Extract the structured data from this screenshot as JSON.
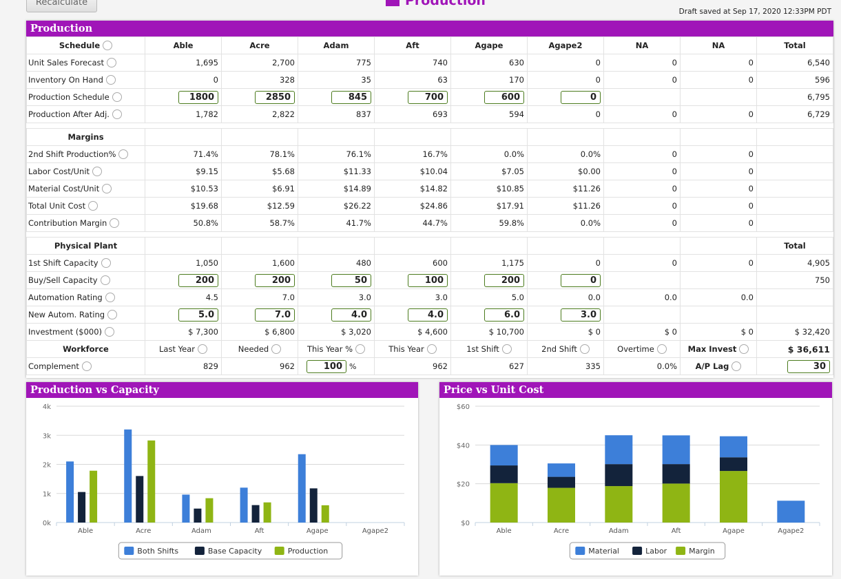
{
  "header": {
    "recalculate_label": "Recalculate",
    "page_title": "Production",
    "draft_saved": "Draft saved at Sep 17, 2020 12:33PM PDT"
  },
  "production_panel": {
    "title": "Production",
    "rows": [
      {
        "type": "head",
        "label": "Schedule",
        "info": true,
        "cells": [
          "Able",
          "Acre",
          "Adam",
          "Aft",
          "Agape",
          "Agape2",
          "NA",
          "NA",
          "Total"
        ]
      },
      {
        "label": "Unit Sales Forecast",
        "info": true,
        "cells": [
          "1,695",
          "2,700",
          "775",
          "740",
          "630",
          "0",
          "0",
          "0",
          "6,540"
        ]
      },
      {
        "label": "Inventory On Hand",
        "info": true,
        "cells": [
          "0",
          "328",
          "35",
          "63",
          "170",
          "0",
          "0",
          "0",
          "596"
        ]
      },
      {
        "label": "Production Schedule",
        "info": true,
        "cells": [
          {
            "input": "1800"
          },
          {
            "input": "2850"
          },
          {
            "input": "845"
          },
          {
            "input": "700"
          },
          {
            "input": "600"
          },
          {
            "input": "0"
          },
          "",
          "",
          "6,795"
        ]
      },
      {
        "label": "Production After Adj.",
        "info": true,
        "cells": [
          "1,782",
          "2,822",
          "837",
          "693",
          "594",
          "0",
          "0",
          "0",
          "6,729"
        ]
      },
      {
        "type": "gap"
      },
      {
        "type": "head",
        "label": "Margins",
        "cells": [
          "",
          "",
          "",
          "",
          "",
          "",
          "",
          "",
          ""
        ]
      },
      {
        "label": "2nd Shift Production%",
        "info": true,
        "cells": [
          "71.4%",
          "78.1%",
          "76.1%",
          "16.7%",
          "0.0%",
          "0.0%",
          "0",
          "0",
          ""
        ]
      },
      {
        "label": "Labor Cost/Unit",
        "info": true,
        "cells": [
          "$9.15",
          "$5.68",
          "$11.33",
          "$10.04",
          "$7.05",
          "$0.00",
          "0",
          "0",
          ""
        ]
      },
      {
        "label": "Material Cost/Unit",
        "info": true,
        "cells": [
          "$10.53",
          "$6.91",
          "$14.89",
          "$14.82",
          "$10.85",
          "$11.26",
          "0",
          "0",
          ""
        ]
      },
      {
        "label": "Total Unit Cost",
        "info": true,
        "cells": [
          "$19.68",
          "$12.59",
          "$26.22",
          "$24.86",
          "$17.91",
          "$11.26",
          "0",
          "0",
          ""
        ]
      },
      {
        "label": "Contribution Margin",
        "info": true,
        "cells": [
          "50.8%",
          "58.7%",
          "41.7%",
          "44.7%",
          "59.8%",
          "0.0%",
          "0",
          "0",
          ""
        ]
      },
      {
        "type": "gap"
      },
      {
        "type": "head",
        "label": "Physical Plant",
        "cells": [
          "",
          "",
          "",
          "",
          "",
          "",
          "",
          "",
          "Total"
        ]
      },
      {
        "label": "1st Shift Capacity",
        "info": true,
        "cells": [
          "1,050",
          "1,600",
          "480",
          "600",
          "1,175",
          "0",
          "0",
          "0",
          "4,905"
        ]
      },
      {
        "label": "Buy/Sell Capacity",
        "info": true,
        "cells": [
          {
            "input": "200"
          },
          {
            "input": "200"
          },
          {
            "input": "50"
          },
          {
            "input": "100"
          },
          {
            "input": "200"
          },
          {
            "input": "0"
          },
          "",
          "",
          "750"
        ]
      },
      {
        "label": "Automation Rating",
        "info": true,
        "cells": [
          "4.5",
          "7.0",
          "3.0",
          "3.0",
          "5.0",
          "0.0",
          "0.0",
          "0.0",
          ""
        ]
      },
      {
        "label": "New Autom. Rating",
        "info": true,
        "cells": [
          {
            "input": "5.0"
          },
          {
            "input": "7.0"
          },
          {
            "input": "4.0"
          },
          {
            "input": "4.0"
          },
          {
            "input": "6.0"
          },
          {
            "input": "3.0"
          },
          "",
          "",
          ""
        ]
      },
      {
        "label": "Investment ($000)",
        "info": true,
        "cells": [
          "$ 7,300",
          "$ 6,800",
          "$ 3,020",
          "$ 4,600",
          "$ 10,700",
          "$ 0",
          "$ 0",
          "$ 0",
          "$ 32,420"
        ]
      },
      {
        "type": "head",
        "label": "Workforce",
        "cells": [
          {
            "label": "Last Year",
            "info": true
          },
          {
            "label": "Needed",
            "info": true
          },
          {
            "label": "This Year %",
            "info": true
          },
          {
            "label": "This Year",
            "info": true
          },
          {
            "label": "1st Shift",
            "info": true
          },
          {
            "label": "2nd Shift",
            "info": true
          },
          {
            "label": "Overtime",
            "info": true
          },
          {
            "label": "Max Invest",
            "info": true,
            "bold": true
          },
          {
            "value": "$ 36,611",
            "bold": true
          }
        ]
      },
      {
        "label": "Complement",
        "info": true,
        "cells": [
          "829",
          "962",
          {
            "input": "100",
            "suffix": "%"
          },
          "962",
          "627",
          "335",
          "0.0%",
          {
            "label": "A/P Lag",
            "info": true,
            "bold": true
          },
          {
            "input": "30",
            "wide": true
          }
        ]
      }
    ]
  },
  "chart_data": [
    {
      "type": "bar",
      "title": "Production vs Capacity",
      "categories": [
        "Able",
        "Acre",
        "Adam",
        "Aft",
        "Agape",
        "Agape2"
      ],
      "ylim": [
        0,
        4000
      ],
      "yticks": [
        "0k",
        "1k",
        "2k",
        "3k",
        "4k"
      ],
      "ytick_values": [
        0,
        1000,
        2000,
        3000,
        4000
      ],
      "grid": true,
      "legend": "bottom",
      "series": [
        {
          "name": "Both Shifts",
          "color": "#3d7fd9",
          "values": [
            2100,
            3200,
            960,
            1200,
            2350,
            0
          ]
        },
        {
          "name": "Base Capacity",
          "color": "#13233b",
          "values": [
            1050,
            1600,
            480,
            600,
            1175,
            0
          ]
        },
        {
          "name": "Production",
          "color": "#8fb514",
          "values": [
            1782,
            2822,
            837,
            693,
            594,
            0
          ]
        }
      ]
    },
    {
      "type": "bar",
      "stacked": true,
      "title": "Price vs Unit Cost",
      "categories": [
        "Able",
        "Acre",
        "Adam",
        "Aft",
        "Agape",
        "Agape2"
      ],
      "ylim": [
        0,
        60
      ],
      "yticks": [
        "$0",
        "$20",
        "$40",
        "$60"
      ],
      "ytick_values": [
        0,
        20,
        40,
        60
      ],
      "grid": true,
      "legend": "bottom",
      "series": [
        {
          "name": "Material",
          "color": "#3d7fd9",
          "values": [
            10.53,
            6.91,
            14.89,
            14.82,
            10.85,
            11.26
          ]
        },
        {
          "name": "Labor",
          "color": "#13233b",
          "values": [
            9.15,
            5.68,
            11.33,
            10.04,
            7.05,
            0
          ]
        },
        {
          "name": "Margin",
          "color": "#8fb514",
          "values": [
            20.3,
            17.9,
            18.8,
            20.1,
            26.6,
            0
          ]
        }
      ]
    }
  ]
}
